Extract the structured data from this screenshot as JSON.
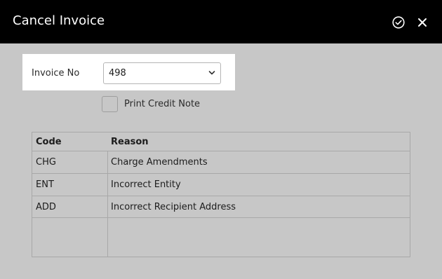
{
  "window": {
    "title": "Cancel Invoice",
    "confirm_icon": "check-circle-icon",
    "close_icon": "close-icon"
  },
  "form": {
    "invoice_label": "Invoice No",
    "invoice_value": "498",
    "print_credit_note_label": "Print Credit Note",
    "print_credit_note_checked": false
  },
  "table": {
    "columns": [
      "Code",
      "Reason"
    ],
    "rows": [
      {
        "code": "CHG",
        "reason": "Charge Amendments"
      },
      {
        "code": "ENT",
        "reason": "Incorrect Entity"
      },
      {
        "code": "ADD",
        "reason": "Incorrect Recipient Address"
      }
    ]
  },
  "colors": {
    "header_bg": "#000000",
    "body_bg": "#c7c7c7",
    "panel_bg": "#ffffff"
  }
}
